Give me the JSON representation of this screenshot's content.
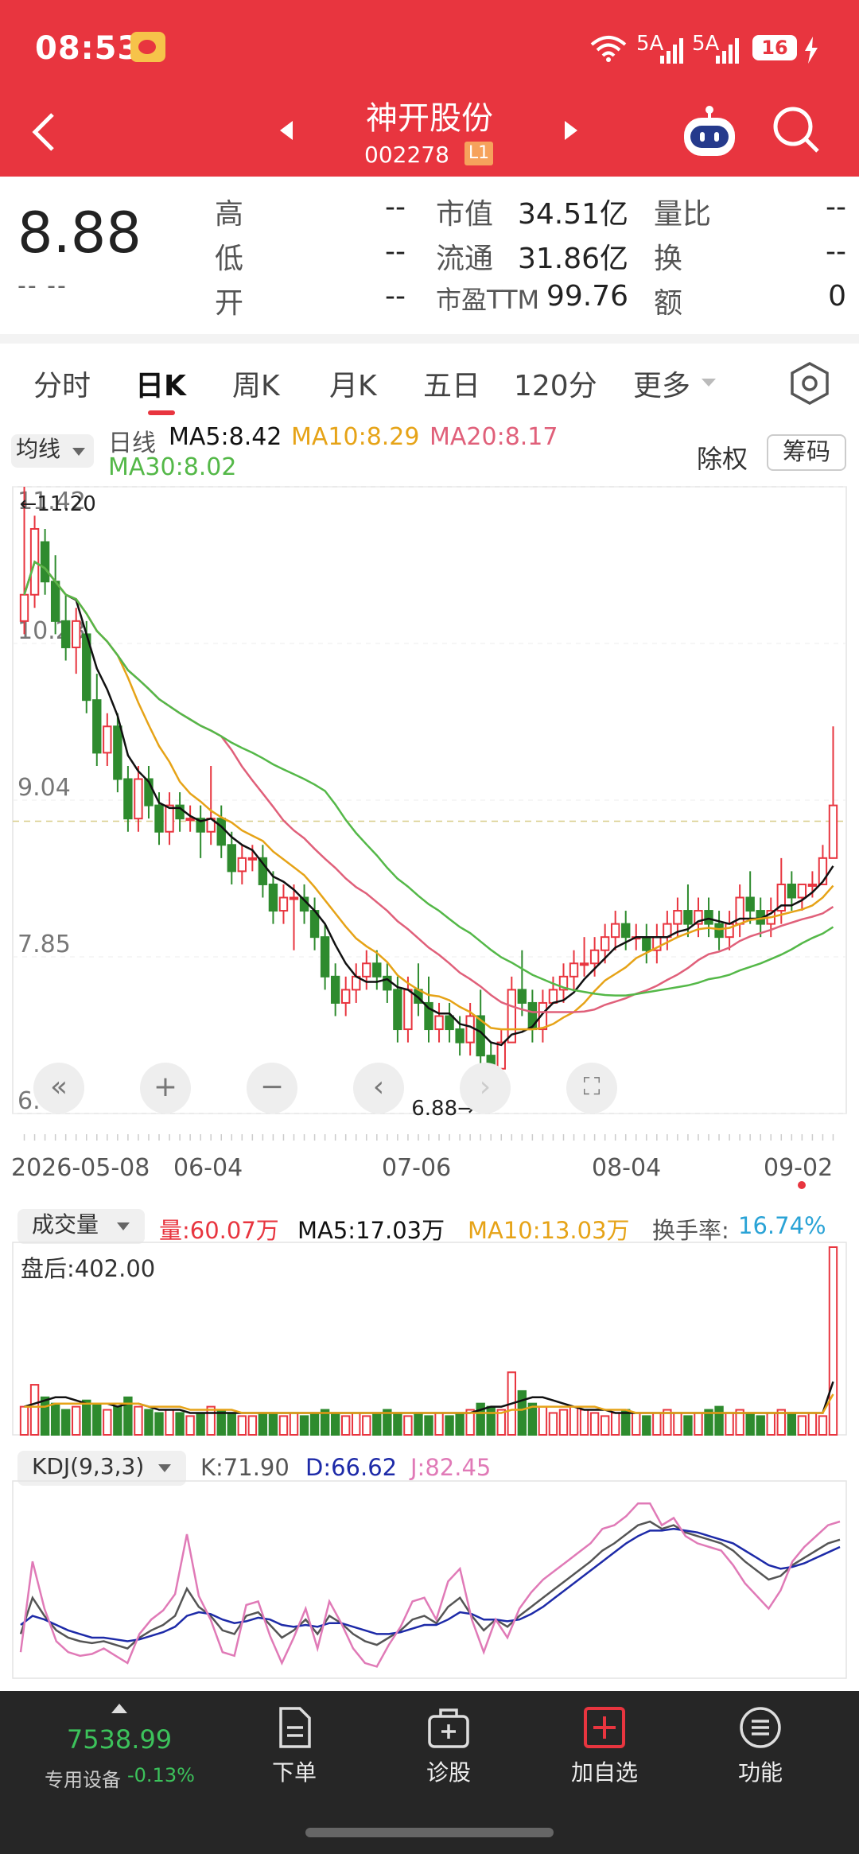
{
  "status_bar": {
    "time": "08:53",
    "signal1": "5A",
    "signal2": "5A",
    "battery": "16"
  },
  "nav": {
    "back_icon": "chevron-left-icon",
    "title": "神开股份",
    "code": "002278",
    "level": "L1",
    "robot_icon": "robot-icon",
    "search_icon": "search-icon"
  },
  "quote": {
    "price": "8.88",
    "change": "-- --",
    "high_label": "高",
    "high": "--",
    "low_label": "低",
    "low": "--",
    "open_label": "开",
    "open": "--",
    "mcap_label": "市值",
    "mcap": "34.51亿",
    "float_label": "流通",
    "float": "31.86亿",
    "pe_label": "市盈TTM",
    "pe": "99.76",
    "ratio_label": "量比",
    "ratio": "--",
    "turnover_label": "换",
    "turnover": "--",
    "amount_label": "额",
    "amount": "0"
  },
  "tabs": [
    "分时",
    "日K",
    "周K",
    "月K",
    "五日",
    "120分",
    "更多"
  ],
  "active_tab": "日K",
  "kline": {
    "indicator": "均线",
    "period": "日线",
    "ma5": "MA5:8.42",
    "ma10": "MA10:8.29",
    "ma20": "MA20:8.17",
    "ma30": "MA30:8.02",
    "chuquan": "除权",
    "chouma": "筹码",
    "high_mark": "11.20",
    "low_mark": "6.88",
    "y_labels": [
      "11.42",
      "10.23",
      "9.04",
      "7.85",
      "6.66"
    ],
    "x_labels": [
      "2026-05-08",
      "06-04",
      "07-06",
      "08-04",
      "09-02"
    ]
  },
  "volume": {
    "indicator": "成交量",
    "vol": "量:60.07万",
    "ma5": "MA5:17.03万",
    "ma10": "MA10:13.03万",
    "turnover_label": "换手率:",
    "turnover": "16.74%",
    "after_hours": "盘后:402.00"
  },
  "kdj": {
    "indicator": "KDJ(9,3,3)",
    "k": "K:71.90",
    "d": "D:66.62",
    "j": "J:82.45"
  },
  "bottom_nav": {
    "index_value": "7538.99",
    "index_label": "专用设备",
    "index_change": "-0.13%",
    "items": [
      "下单",
      "诊股",
      "加自选",
      "功能"
    ]
  },
  "colors": {
    "red": "#e8353f",
    "green": "#2e8b2e",
    "ma5": "#111111",
    "ma10": "#e6a317",
    "ma20": "#e0607a",
    "ma30": "#54b848"
  },
  "chart_data": {
    "type": "candlestick",
    "price_range": [
      6.66,
      11.42
    ],
    "candles": [
      {
        "o": 10.4,
        "h": 11.42,
        "l": 10.3,
        "c": 10.6
      },
      {
        "o": 10.6,
        "h": 11.2,
        "l": 10.5,
        "c": 11.1
      },
      {
        "o": 11.0,
        "h": 11.1,
        "l": 10.6,
        "c": 10.7
      },
      {
        "o": 10.7,
        "h": 10.9,
        "l": 10.3,
        "c": 10.4
      },
      {
        "o": 10.4,
        "h": 10.6,
        "l": 10.1,
        "c": 10.2
      },
      {
        "o": 10.2,
        "h": 10.5,
        "l": 10.0,
        "c": 10.4
      },
      {
        "o": 10.3,
        "h": 10.4,
        "l": 9.7,
        "c": 9.8
      },
      {
        "o": 9.8,
        "h": 10.0,
        "l": 9.3,
        "c": 9.4
      },
      {
        "o": 9.4,
        "h": 9.7,
        "l": 9.3,
        "c": 9.6
      },
      {
        "o": 9.6,
        "h": 9.7,
        "l": 9.1,
        "c": 9.2
      },
      {
        "o": 9.2,
        "h": 9.3,
        "l": 8.8,
        "c": 8.9
      },
      {
        "o": 8.9,
        "h": 9.3,
        "l": 8.8,
        "c": 9.2
      },
      {
        "o": 9.2,
        "h": 9.3,
        "l": 8.9,
        "c": 9.0
      },
      {
        "o": 9.0,
        "h": 9.1,
        "l": 8.7,
        "c": 8.8
      },
      {
        "o": 8.8,
        "h": 9.1,
        "l": 8.7,
        "c": 9.0
      },
      {
        "o": 9.0,
        "h": 9.1,
        "l": 8.8,
        "c": 8.9
      },
      {
        "o": 8.9,
        "h": 9.0,
        "l": 8.8,
        "c": 8.9
      },
      {
        "o": 8.9,
        "h": 9.0,
        "l": 8.6,
        "c": 8.8
      },
      {
        "o": 8.8,
        "h": 9.3,
        "l": 8.7,
        "c": 8.9
      },
      {
        "o": 8.9,
        "h": 9.0,
        "l": 8.6,
        "c": 8.7
      },
      {
        "o": 8.7,
        "h": 8.8,
        "l": 8.4,
        "c": 8.5
      },
      {
        "o": 8.5,
        "h": 8.7,
        "l": 8.4,
        "c": 8.6
      },
      {
        "o": 8.6,
        "h": 8.7,
        "l": 8.5,
        "c": 8.6
      },
      {
        "o": 8.6,
        "h": 8.7,
        "l": 8.3,
        "c": 8.4
      },
      {
        "o": 8.4,
        "h": 8.5,
        "l": 8.1,
        "c": 8.2
      },
      {
        "o": 8.2,
        "h": 8.4,
        "l": 8.1,
        "c": 8.3
      },
      {
        "o": 8.3,
        "h": 8.4,
        "l": 7.9,
        "c": 8.3
      },
      {
        "o": 8.3,
        "h": 8.4,
        "l": 8.1,
        "c": 8.2
      },
      {
        "o": 8.2,
        "h": 8.3,
        "l": 7.9,
        "c": 8.0
      },
      {
        "o": 8.0,
        "h": 8.1,
        "l": 7.6,
        "c": 7.7
      },
      {
        "o": 7.7,
        "h": 7.8,
        "l": 7.4,
        "c": 7.5
      },
      {
        "o": 7.5,
        "h": 7.7,
        "l": 7.4,
        "c": 7.6
      },
      {
        "o": 7.6,
        "h": 7.8,
        "l": 7.5,
        "c": 7.7
      },
      {
        "o": 7.7,
        "h": 7.9,
        "l": 7.6,
        "c": 7.8
      },
      {
        "o": 7.8,
        "h": 7.9,
        "l": 7.6,
        "c": 7.7
      },
      {
        "o": 7.7,
        "h": 7.8,
        "l": 7.5,
        "c": 7.6
      },
      {
        "o": 7.6,
        "h": 7.7,
        "l": 7.2,
        "c": 7.3
      },
      {
        "o": 7.3,
        "h": 7.7,
        "l": 7.2,
        "c": 7.6
      },
      {
        "o": 7.6,
        "h": 7.8,
        "l": 7.4,
        "c": 7.5
      },
      {
        "o": 7.5,
        "h": 7.7,
        "l": 7.2,
        "c": 7.3
      },
      {
        "o": 7.3,
        "h": 7.5,
        "l": 7.2,
        "c": 7.4
      },
      {
        "o": 7.4,
        "h": 7.5,
        "l": 7.2,
        "c": 7.3
      },
      {
        "o": 7.3,
        "h": 7.4,
        "l": 7.1,
        "c": 7.2
      },
      {
        "o": 7.2,
        "h": 7.5,
        "l": 7.1,
        "c": 7.4
      },
      {
        "o": 7.4,
        "h": 7.6,
        "l": 7.0,
        "c": 7.1
      },
      {
        "o": 7.1,
        "h": 7.2,
        "l": 6.88,
        "c": 7.0
      },
      {
        "o": 7.0,
        "h": 7.3,
        "l": 6.95,
        "c": 7.2
      },
      {
        "o": 7.2,
        "h": 7.7,
        "l": 7.2,
        "c": 7.6
      },
      {
        "o": 7.6,
        "h": 7.9,
        "l": 7.4,
        "c": 7.5
      },
      {
        "o": 7.5,
        "h": 7.6,
        "l": 7.2,
        "c": 7.3
      },
      {
        "o": 7.3,
        "h": 7.6,
        "l": 7.2,
        "c": 7.5
      },
      {
        "o": 7.5,
        "h": 7.7,
        "l": 7.5,
        "c": 7.6
      },
      {
        "o": 7.6,
        "h": 7.8,
        "l": 7.5,
        "c": 7.7
      },
      {
        "o": 7.7,
        "h": 7.9,
        "l": 7.6,
        "c": 7.8
      },
      {
        "o": 7.8,
        "h": 8.0,
        "l": 7.7,
        "c": 7.8
      },
      {
        "o": 7.8,
        "h": 8.0,
        "l": 7.7,
        "c": 7.9
      },
      {
        "o": 7.9,
        "h": 8.1,
        "l": 7.8,
        "c": 8.0
      },
      {
        "o": 8.0,
        "h": 8.2,
        "l": 7.9,
        "c": 8.1
      },
      {
        "o": 8.1,
        "h": 8.2,
        "l": 7.9,
        "c": 8.0
      },
      {
        "o": 8.0,
        "h": 8.1,
        "l": 7.9,
        "c": 8.0
      },
      {
        "o": 8.0,
        "h": 8.1,
        "l": 7.8,
        "c": 7.9
      },
      {
        "o": 7.9,
        "h": 8.1,
        "l": 7.8,
        "c": 8.0
      },
      {
        "o": 8.0,
        "h": 8.2,
        "l": 7.9,
        "c": 8.1
      },
      {
        "o": 8.1,
        "h": 8.3,
        "l": 8.0,
        "c": 8.2
      },
      {
        "o": 8.2,
        "h": 8.4,
        "l": 8.0,
        "c": 8.1
      },
      {
        "o": 8.1,
        "h": 8.3,
        "l": 8.0,
        "c": 8.2
      },
      {
        "o": 8.2,
        "h": 8.3,
        "l": 8.0,
        "c": 8.1
      },
      {
        "o": 8.1,
        "h": 8.2,
        "l": 7.9,
        "c": 8.0
      },
      {
        "o": 8.0,
        "h": 8.2,
        "l": 7.9,
        "c": 8.1
      },
      {
        "o": 8.1,
        "h": 8.4,
        "l": 8.0,
        "c": 8.3
      },
      {
        "o": 8.3,
        "h": 8.5,
        "l": 8.1,
        "c": 8.2
      },
      {
        "o": 8.2,
        "h": 8.3,
        "l": 8.0,
        "c": 8.1
      },
      {
        "o": 8.1,
        "h": 8.3,
        "l": 8.0,
        "c": 8.2
      },
      {
        "o": 8.2,
        "h": 8.6,
        "l": 8.1,
        "c": 8.4
      },
      {
        "o": 8.4,
        "h": 8.5,
        "l": 8.2,
        "c": 8.3
      },
      {
        "o": 8.3,
        "h": 8.4,
        "l": 8.2,
        "c": 8.4
      },
      {
        "o": 8.4,
        "h": 8.5,
        "l": 8.3,
        "c": 8.4
      },
      {
        "o": 8.4,
        "h": 8.7,
        "l": 8.4,
        "c": 8.6
      },
      {
        "o": 8.6,
        "h": 9.6,
        "l": 8.6,
        "c": 9.0
      }
    ],
    "volume": [
      9,
      16,
      12,
      10,
      8,
      9,
      11,
      10,
      8,
      9,
      12,
      9,
      8,
      7,
      8,
      7,
      6,
      7,
      9,
      8,
      7,
      6,
      6,
      7,
      7,
      6,
      7,
      6,
      7,
      8,
      7,
      6,
      7,
      6,
      7,
      8,
      7,
      6,
      7,
      6,
      7,
      6,
      7,
      8,
      10,
      9,
      8,
      20,
      14,
      10,
      9,
      7,
      8,
      9,
      8,
      7,
      6,
      7,
      8,
      7,
      6,
      7,
      8,
      7,
      6,
      7,
      8,
      9,
      7,
      8,
      7,
      6,
      7,
      8,
      7,
      6,
      7,
      6,
      60
    ],
    "vol_ma5": [
      9,
      10,
      11,
      12,
      12,
      11,
      10,
      10,
      10,
      9,
      10,
      10,
      9,
      8,
      8,
      8,
      7,
      7,
      7,
      7,
      7,
      7,
      7,
      7,
      7,
      7,
      7,
      7,
      7,
      7,
      7,
      7,
      7,
      7,
      7,
      7,
      7,
      7,
      7,
      7,
      7,
      7,
      7,
      7,
      8,
      9,
      9,
      10,
      11,
      12,
      12,
      11,
      10,
      9,
      8,
      8,
      8,
      7,
      7,
      7,
      7,
      7,
      7,
      7,
      7,
      7,
      7,
      7,
      7,
      7,
      7,
      7,
      7,
      7,
      7,
      7,
      7,
      7,
      17
    ],
    "vol_ma10": [
      9,
      9,
      9,
      10,
      10,
      10,
      10,
      10,
      10,
      10,
      10,
      10,
      9,
      9,
      9,
      9,
      8,
      8,
      8,
      8,
      8,
      7,
      7,
      7,
      7,
      7,
      7,
      7,
      7,
      7,
      7,
      7,
      7,
      7,
      7,
      7,
      7,
      7,
      7,
      7,
      7,
      7,
      7,
      7,
      7,
      7,
      7,
      8,
      8,
      9,
      9,
      9,
      9,
      9,
      9,
      9,
      8,
      8,
      8,
      7,
      7,
      7,
      7,
      7,
      7,
      7,
      7,
      7,
      7,
      7,
      7,
      7,
      7,
      7,
      7,
      7,
      7,
      7,
      13
    ],
    "kdj_k": [
      20,
      40,
      30,
      22,
      18,
      16,
      15,
      16,
      14,
      12,
      18,
      22,
      25,
      30,
      45,
      35,
      30,
      22,
      20,
      30,
      32,
      25,
      18,
      22,
      28,
      20,
      30,
      26,
      20,
      16,
      14,
      18,
      22,
      28,
      30,
      26,
      35,
      40,
      30,
      22,
      28,
      24,
      30,
      35,
      40,
      45,
      50,
      55,
      60,
      66,
      70,
      75,
      80,
      82,
      78,
      80,
      76,
      74,
      72,
      70,
      66,
      60,
      55,
      50,
      52,
      58,
      62,
      66,
      70,
      72
    ],
    "kdj_d": [
      25,
      30,
      28,
      25,
      22,
      20,
      18,
      18,
      17,
      16,
      17,
      19,
      21,
      24,
      30,
      32,
      31,
      28,
      26,
      27,
      29,
      28,
      25,
      24,
      25,
      24,
      26,
      26,
      24,
      22,
      20,
      20,
      21,
      23,
      25,
      25,
      28,
      32,
      31,
      28,
      28,
      27,
      28,
      31,
      35,
      40,
      45,
      50,
      55,
      60,
      65,
      70,
      74,
      77,
      77,
      78,
      77,
      76,
      74,
      72,
      70,
      66,
      62,
      58,
      56,
      57,
      59,
      62,
      65,
      68
    ],
    "kdj_j": [
      10,
      60,
      34,
      16,
      10,
      8,
      9,
      12,
      8,
      4,
      20,
      28,
      33,
      42,
      75,
      41,
      28,
      10,
      8,
      36,
      38,
      19,
      4,
      18,
      34,
      12,
      38,
      26,
      12,
      4,
      2,
      14,
      24,
      38,
      40,
      28,
      49,
      56,
      28,
      10,
      28,
      18,
      34,
      43,
      50,
      55,
      60,
      65,
      70,
      78,
      80,
      85,
      92,
      92,
      80,
      84,
      74,
      70,
      68,
      66,
      58,
      48,
      41,
      34,
      44,
      60,
      68,
      74,
      80,
      82
    ]
  }
}
